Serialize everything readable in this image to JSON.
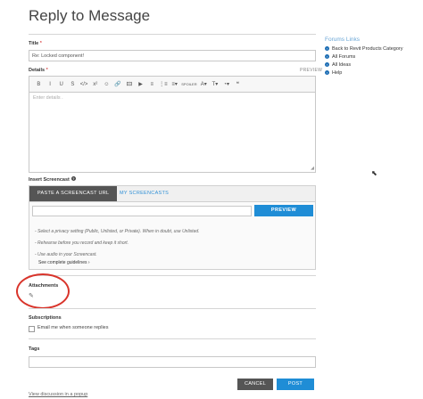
{
  "page": {
    "title": "Reply to Message"
  },
  "form": {
    "title_label": "Title",
    "title_required": "*",
    "title_value": "Re: Locked component!",
    "details_label": "Details",
    "details_required": "*",
    "preview_link": "PREVIEW",
    "editor_placeholder": "Enter details .",
    "toolbar": [
      {
        "name": "bold-icon",
        "glyph": "B"
      },
      {
        "name": "italic-icon",
        "glyph": "I"
      },
      {
        "name": "underline-icon",
        "glyph": "U"
      },
      {
        "name": "strikethrough-icon",
        "glyph": "S"
      },
      {
        "name": "code-icon",
        "glyph": "</>"
      },
      {
        "name": "superscript-icon",
        "glyph": "x²"
      },
      {
        "name": "emoji-icon",
        "glyph": "☺"
      },
      {
        "name": "link-icon",
        "glyph": "🔗"
      },
      {
        "name": "image-icon",
        "glyph": "🖾"
      },
      {
        "name": "video-icon",
        "glyph": "▶"
      },
      {
        "name": "bulleted-list-icon",
        "glyph": "≡"
      },
      {
        "name": "numbered-list-icon",
        "glyph": "⋮≡"
      },
      {
        "name": "align-icon",
        "glyph": "≡▾"
      },
      {
        "name": "spoiler-icon",
        "glyph": "SPOILER"
      },
      {
        "name": "font-icon",
        "glyph": "A▾"
      },
      {
        "name": "text-size-icon",
        "glyph": "T▾"
      },
      {
        "name": "color-icon",
        "glyph": "◔▾"
      },
      {
        "name": "quote-icon",
        "glyph": "❝"
      }
    ],
    "screencast_label": "Insert Screencast",
    "screencast": {
      "tab_paste": "PASTE A SCREENCAST URL",
      "tab_my": "MY SCREENCASTS",
      "url_value": "",
      "preview_button": "PREVIEW",
      "tips": [
        "- Select a privacy setting (Public, Unlisted, or Private). When in doubt, use Unlisted.",
        "- Rehearse before you record and keep it short.",
        "- Use audio in your Screencast."
      ],
      "guidelines_link": "See complete guidelines ›"
    },
    "attachments_label": "Attachments",
    "subscriptions_label": "Subscriptions",
    "email_option": "Email me when someone replies",
    "email_checked": false,
    "tags_label": "Tags",
    "tags_value": "",
    "cancel_button": "CANCEL",
    "post_button": "POST",
    "popup_link": "View discussion in a popup"
  },
  "forum_links": {
    "title": "Forums Links",
    "items": [
      "Back to Revit Products Category",
      "All Forums",
      "All Ideas",
      "Help"
    ]
  },
  "colors": {
    "accent": "#1f8dd6",
    "annotation_circle": "#d9342b",
    "tab_active_bg": "#555555"
  }
}
